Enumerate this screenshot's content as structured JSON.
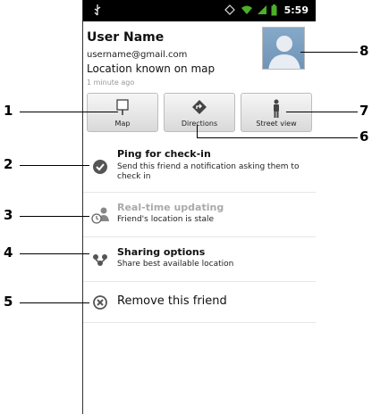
{
  "status_bar": {
    "time": "5:59"
  },
  "user": {
    "name": "User Name",
    "email": "username@gmail.com",
    "location_status": "Location known on map",
    "updated": "1 minute ago"
  },
  "buttons": {
    "map": "Map",
    "directions": "Directions",
    "street_view": "Street view"
  },
  "menu": {
    "ping": {
      "title": "Ping for check-in",
      "subtitle": "Send this friend a notification asking them to check in"
    },
    "realtime": {
      "title": "Real-time updating",
      "subtitle": "Friend's location is stale"
    },
    "sharing": {
      "title": "Sharing options",
      "subtitle": "Share best available location"
    },
    "remove": {
      "title": "Remove this friend"
    }
  },
  "callouts": [
    "1",
    "2",
    "3",
    "4",
    "5",
    "6",
    "7",
    "8"
  ]
}
